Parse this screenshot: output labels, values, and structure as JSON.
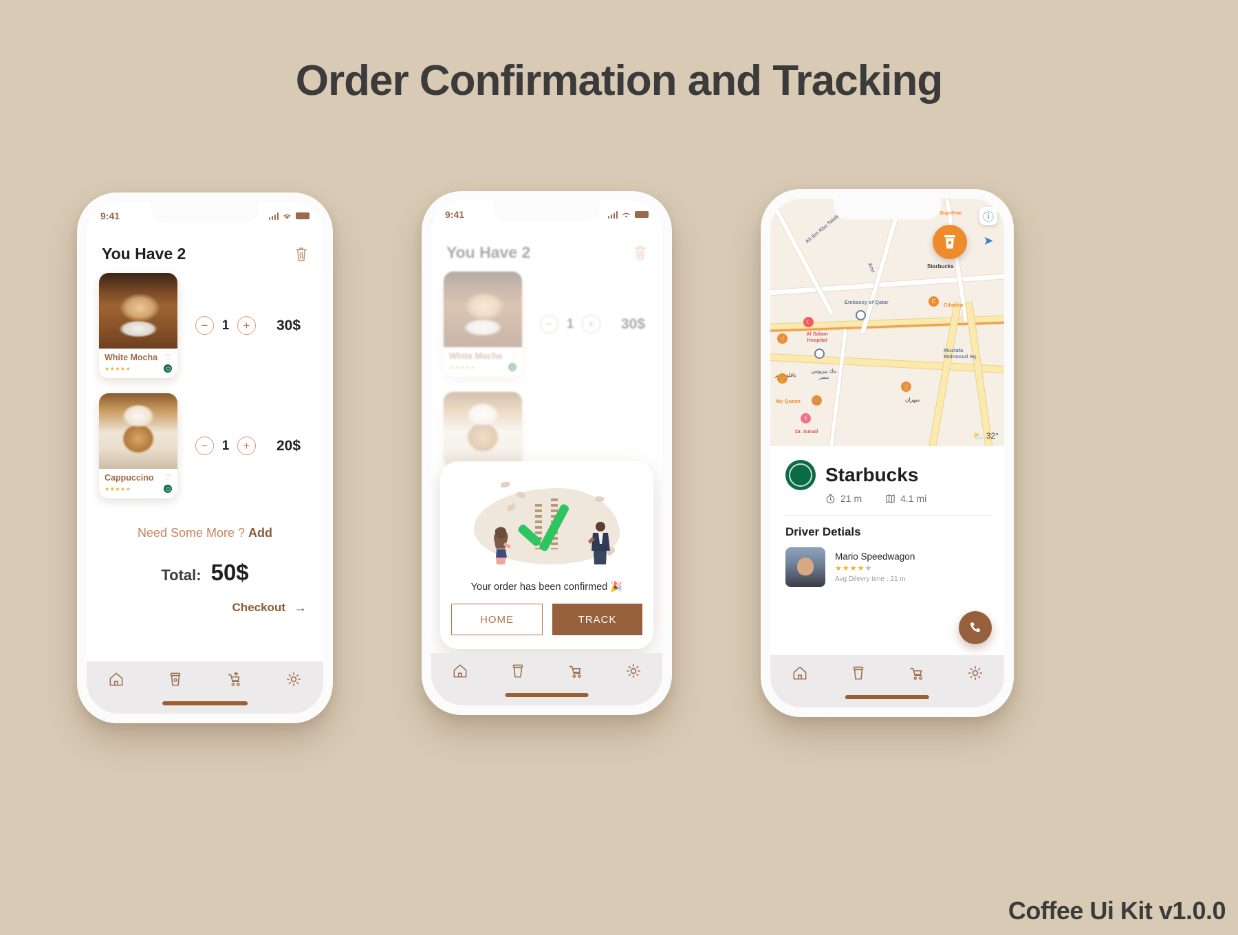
{
  "page": {
    "title": "Order Confirmation and Tracking",
    "kit_version": "Coffee Ui Kit v1.0.0"
  },
  "colors": {
    "background": "#d8cab4",
    "accent_brown": "#96603c",
    "accent_copper": "#c9805a",
    "text_dark": "#1f1f1f",
    "star_gold": "#f0b323",
    "check_green": "#2ec45f",
    "marker_orange": "#f08b2c",
    "starbucks_green": "#0b6b45"
  },
  "status_bar": {
    "time": "9:41",
    "signal_icon": "signal-bars-icon",
    "wifi_icon": "wifi-icon",
    "battery_icon": "battery-icon"
  },
  "tabbar": {
    "items": [
      {
        "icon": "home-icon",
        "name": "home"
      },
      {
        "icon": "coffee-cup-icon",
        "name": "orders"
      },
      {
        "icon": "cart-arrow-icon",
        "name": "cart"
      },
      {
        "icon": "gear-icon",
        "name": "settings"
      }
    ]
  },
  "cart_screen": {
    "heading": "You Have 2",
    "delete_icon": "trash-icon",
    "items": [
      {
        "name": "White Mocha",
        "favorite_icon": "heart-outline-icon",
        "rating_filled": 4,
        "rating_total": 5,
        "brand_icon": "starbucks-logo-icon",
        "minus_label": "−",
        "plus_label": "+",
        "quantity": "1",
        "price": "30$"
      },
      {
        "name": "Cappuccino",
        "favorite_icon": "heart-outline-icon",
        "rating_filled": 4,
        "rating_total": 5,
        "brand_icon": "starbucks-logo-icon",
        "minus_label": "−",
        "plus_label": "+",
        "quantity": "1",
        "price": "20$"
      }
    ],
    "need_more_text": "Need Some More ?",
    "add_label": "Add",
    "total_label": "Total:",
    "total_value": "50$",
    "checkout_label": "Checkout",
    "checkout_arrow": "arrow-right-icon"
  },
  "confirm_screen": {
    "heading": "You Have 2",
    "delete_icon": "trash-icon",
    "item": {
      "name": "White Mocha",
      "quantity": "1",
      "price": "30$",
      "minus_label": "−",
      "plus_label": "+"
    },
    "dialog": {
      "illustration": "order-confirmed-illustration",
      "message": "Your order has been confirmed 🎉",
      "home_button": "HOME",
      "track_button": "TRACK"
    }
  },
  "tracking_screen": {
    "map": {
      "info_icon": "info-icon",
      "navigate_icon": "navigation-arrow-icon",
      "weather_icon": "cloud-sun-icon",
      "temperature": "32°",
      "store_marker_icon": "coffee-cup-icon",
      "store_marker_label": "Starbucks",
      "labels": [
        "Ali Ibn Abu Taleb Street",
        "Amr",
        "Cafe Suprême",
        "Embassy of Qatar",
        "Cilantro",
        "Al Salam Hospital",
        "Mustafa Mahmoud Sq.",
        "My Queen",
        "Dr. Ismail",
        "سهران",
        "بنك بيريوس مصر",
        "بافلو برجر"
      ]
    },
    "store": {
      "logo_icon": "starbucks-logo-icon",
      "name": "Starbucks",
      "time_icon": "stopwatch-icon",
      "time_value": "21 m",
      "distance_icon": "map-icon",
      "distance_value": "4.1 mi"
    },
    "driver": {
      "section_title": "Driver Detials",
      "avatar": "driver-avatar",
      "name": "Mario Speedwagon",
      "rating_filled": 4,
      "rating_total": 5,
      "avg_time": "Avg Dilevry time : 21 m",
      "call_icon": "phone-icon"
    }
  }
}
